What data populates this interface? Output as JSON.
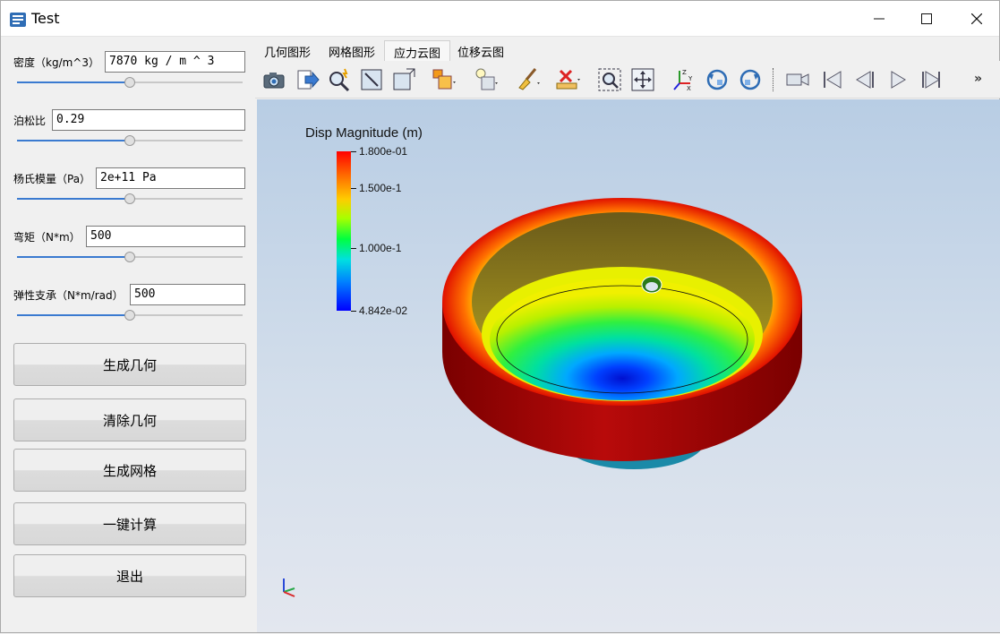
{
  "window": {
    "title": "Test"
  },
  "params": [
    {
      "label": "密度（kg/m^3）",
      "value": "7870 kg / m ^ 3",
      "slider_fraction": 0.5
    },
    {
      "label": "泊松比",
      "value": "0.29",
      "slider_fraction": 0.5
    },
    {
      "label": "杨氏模量（Pa）",
      "value": "2e+11 Pa",
      "slider_fraction": 0.5
    },
    {
      "label": "弯矩（N*m）",
      "value": "500",
      "slider_fraction": 0.5
    },
    {
      "label": "弹性支承（N*m/rad）",
      "value": "500",
      "slider_fraction": 0.5
    }
  ],
  "buttons": {
    "generate_geometry": "生成几何",
    "clear_geometry": "清除几何",
    "generate_mesh": "生成网格",
    "one_click_compute": "一键计算",
    "exit": "退出"
  },
  "tabs": [
    {
      "label": "几何图形",
      "active": false
    },
    {
      "label": "网格图形",
      "active": false
    },
    {
      "label": "应力云图",
      "active": true
    },
    {
      "label": "位移云图",
      "active": false
    }
  ],
  "toolbar_icons": [
    "camera-icon",
    "export-icon",
    "zoom-magic-icon",
    "select-region-icon",
    "box-outline-icon",
    "boxes-dropdown-icon",
    "lightbulb-dropdown-icon",
    "brush-dropdown-icon",
    "clear-dropdown-icon",
    "zoom-to-box-icon",
    "reset-view-icon",
    "axes-orientation-icon",
    "rotate-ccw-icon",
    "rotate-cw-icon",
    "camera-record-icon",
    "first-frame-icon",
    "previous-frame-icon",
    "play-icon",
    "last-frame-icon"
  ],
  "viewport": {
    "legend_title": "Disp Magnitude (m)",
    "legend_ticks": [
      "1.800e-01",
      "1.500e-1",
      "1.000e-1",
      "4.842e-02"
    ]
  },
  "colors": {
    "accent": "#3a7ad0",
    "viewport_top": "#b8cde4",
    "viewport_bottom": "#e3e7ef"
  }
}
